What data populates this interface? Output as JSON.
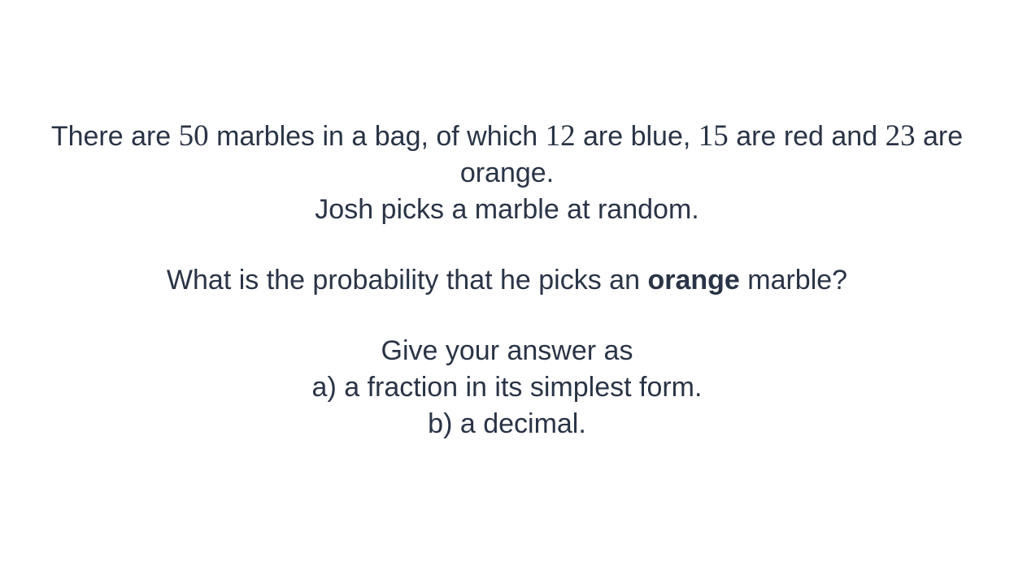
{
  "question": {
    "line1": {
      "t1": "There are ",
      "n1": "50",
      "t2": " marbles in a bag, of which ",
      "n2": "12",
      "t3": " are blue, ",
      "n3": "15",
      "t4": " are red and ",
      "n4": "23",
      "t5": " are orange."
    },
    "line2": "Josh picks a marble at random.",
    "line3": {
      "pre": "What is the probability that he picks an ",
      "bold": "orange",
      "post": " marble?"
    },
    "line4": "Give your answer as",
    "option_a": "a) a fraction in its simplest form.",
    "option_b": "b) a decimal."
  }
}
